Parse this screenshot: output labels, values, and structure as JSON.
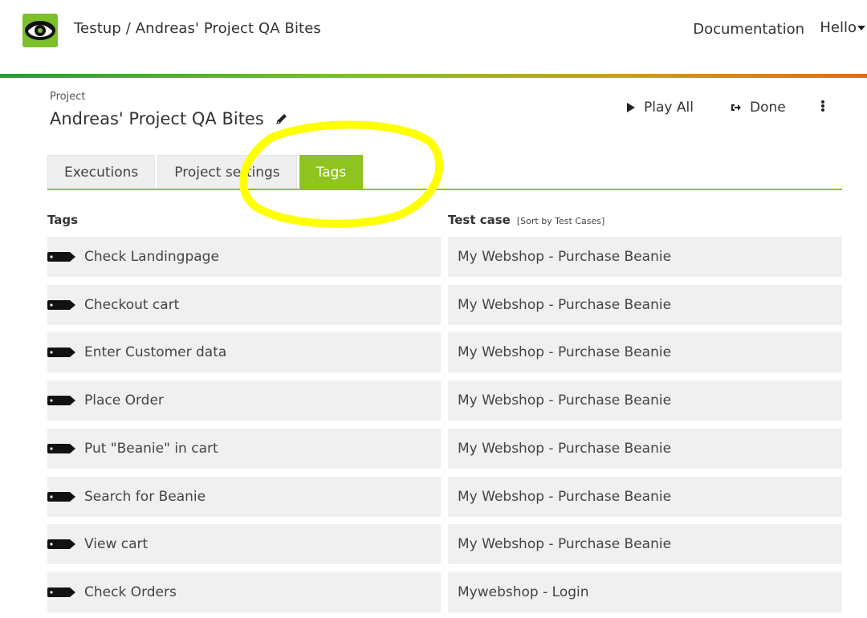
{
  "header": {
    "breadcrumb": "Testup / Andreas' Project QA Bites",
    "documentation": "Documentation",
    "hello": "Hello"
  },
  "project": {
    "label": "Project",
    "title": "Andreas' Project QA Bites"
  },
  "actions": {
    "play_all": "Play All",
    "done": "Done"
  },
  "tabs": [
    {
      "label": "Executions",
      "active": false
    },
    {
      "label": "Project settings",
      "active": false
    },
    {
      "label": "Tags",
      "active": true
    }
  ],
  "table": {
    "tags_header": "Tags",
    "testcase_header": "Test case",
    "sort_link": "[Sort by Test Cases]",
    "rows": [
      {
        "tag": "Check Landingpage",
        "testcase": "My Webshop - Purchase Beanie"
      },
      {
        "tag": "Checkout cart",
        "testcase": "My Webshop - Purchase Beanie"
      },
      {
        "tag": "Enter Customer data",
        "testcase": "My Webshop - Purchase Beanie"
      },
      {
        "tag": "Place Order",
        "testcase": "My Webshop - Purchase Beanie"
      },
      {
        "tag": "Put \"Beanie\" in cart",
        "testcase": "My Webshop - Purchase Beanie"
      },
      {
        "tag": "Search for Beanie",
        "testcase": "My Webshop - Purchase Beanie"
      },
      {
        "tag": "View cart",
        "testcase": "My Webshop - Purchase Beanie"
      },
      {
        "tag": "Check Orders",
        "testcase": "Mywebshop - Login"
      }
    ]
  },
  "colors": {
    "accent": "#8fc31f",
    "highlight": "#ffff00"
  }
}
